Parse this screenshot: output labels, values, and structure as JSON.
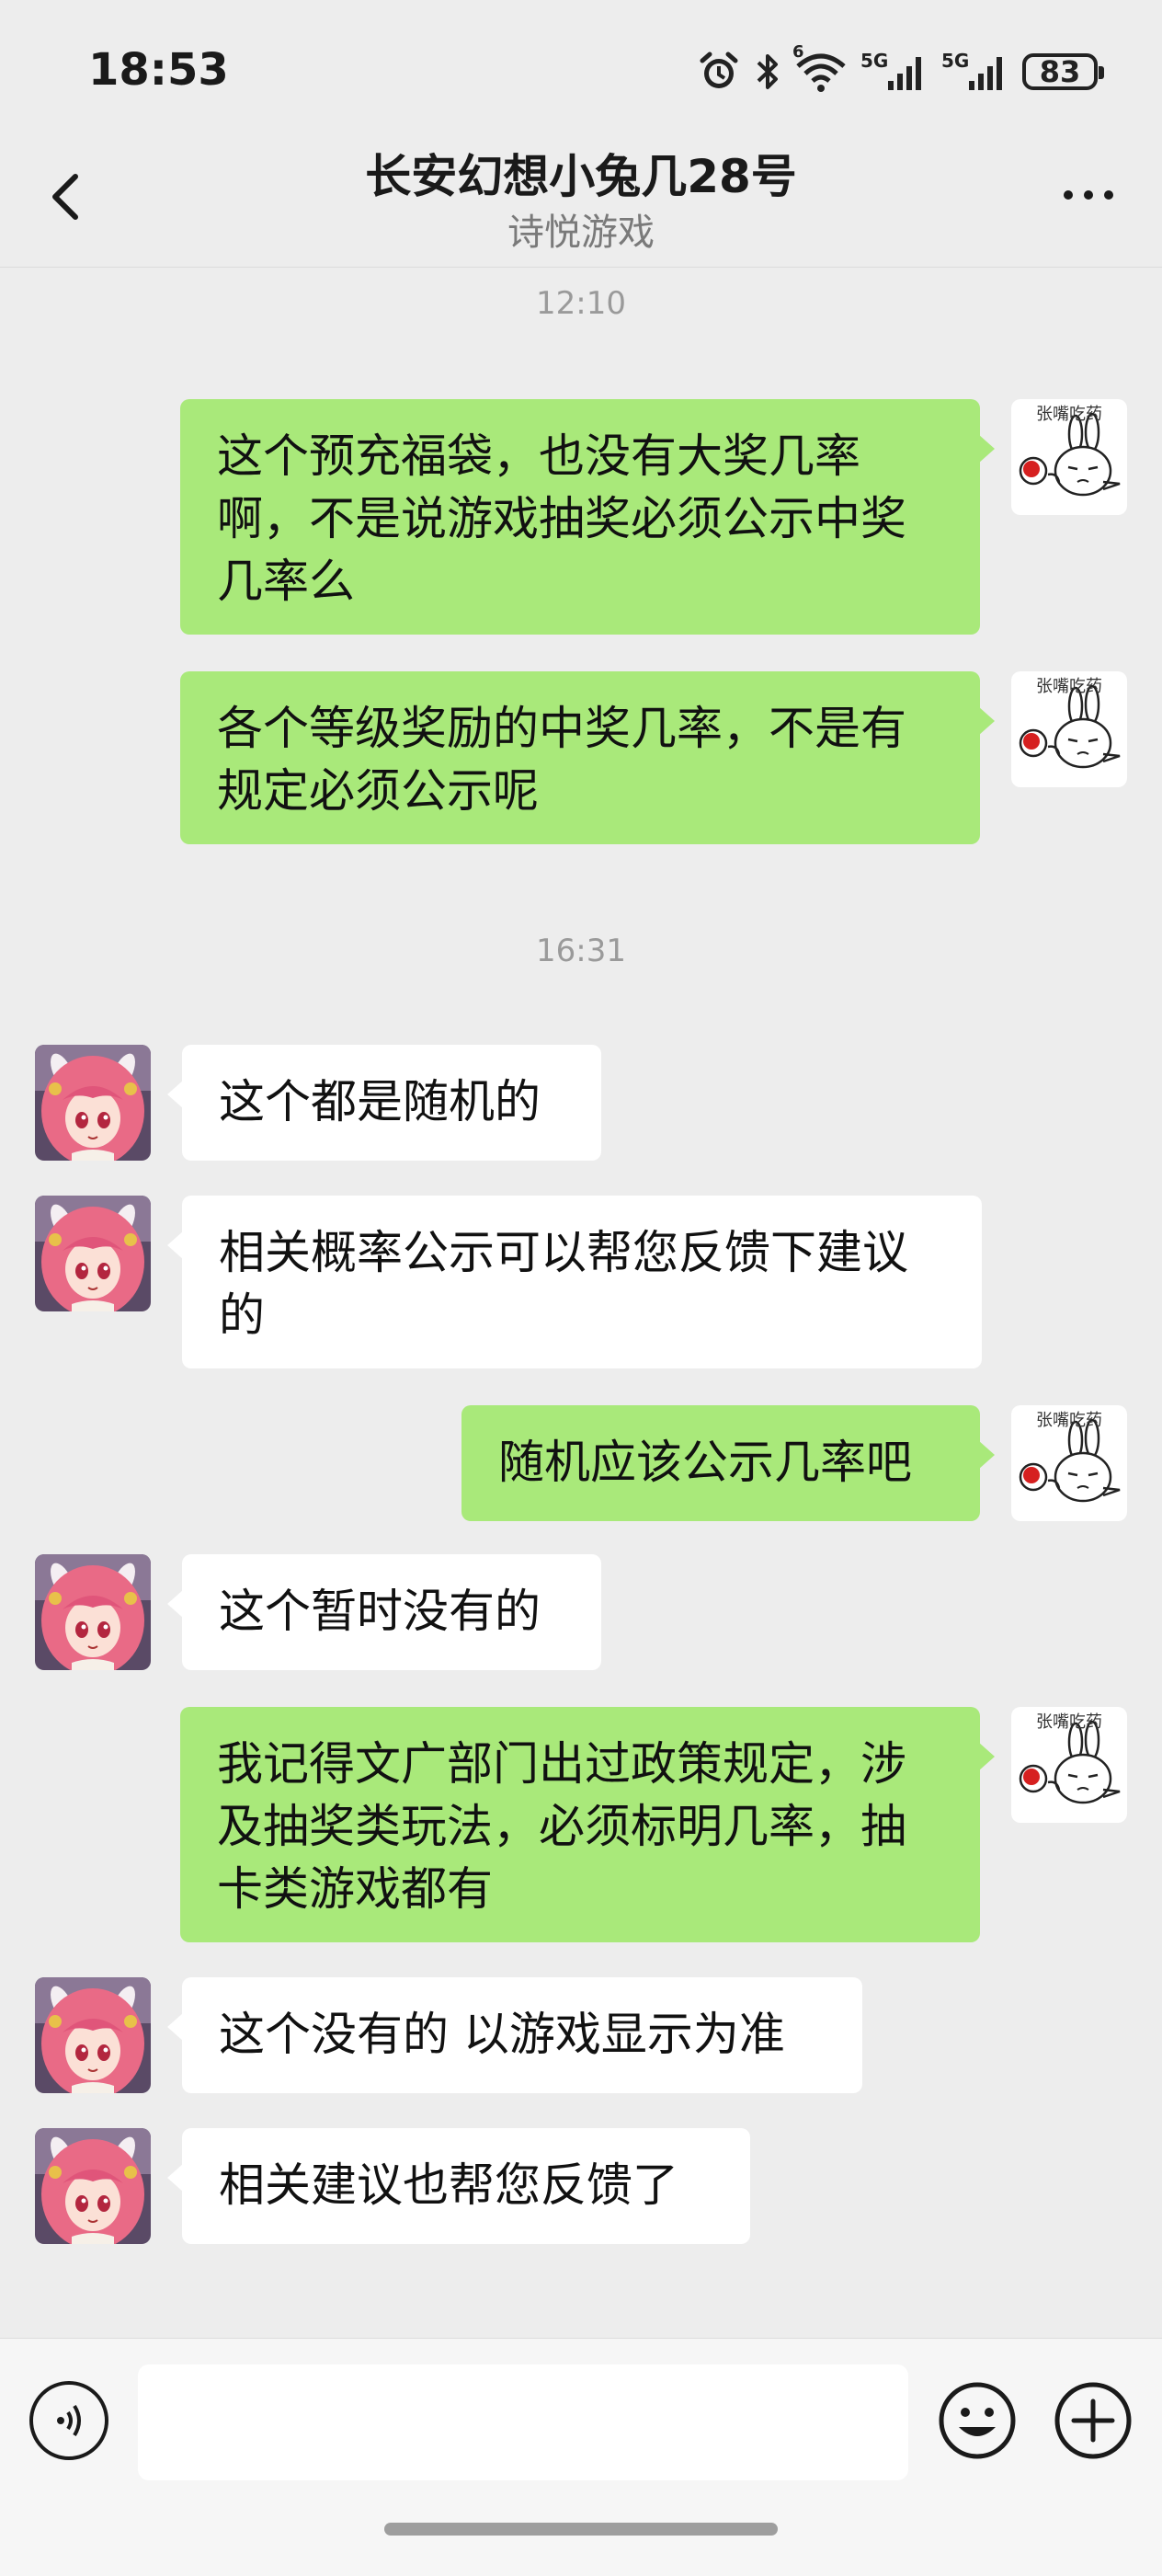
{
  "status_bar": {
    "time": "18:53",
    "battery": "83",
    "network_1": "5G",
    "network_2": "5G",
    "wifi_badge": "6"
  },
  "header": {
    "title": "长安幻想小兔几28号",
    "subtitle": "诗悦游戏"
  },
  "timestamps": [
    "12:10",
    "16:31"
  ],
  "self_avatar_caption": "张嘴吃药",
  "messages": [
    {
      "from": "me",
      "line1": "这个预充福袋，也没有大奖几率",
      "line2": "啊，不是说游戏抽奖必须公示中奖",
      "line3": "几率么"
    },
    {
      "from": "me",
      "line1": "各个等级奖励的中奖几率，不是有",
      "line2": "规定必须公示呢"
    },
    {
      "from": "other",
      "line1": "这个都是随机的"
    },
    {
      "from": "other",
      "line1": "相关概率公示可以帮您反馈下建议",
      "line2": "的"
    },
    {
      "from": "me",
      "line1": "随机应该公示几率吧"
    },
    {
      "from": "other",
      "line1": "这个暂时没有的"
    },
    {
      "from": "me",
      "line1": "我记得文广部门出过政策规定，涉",
      "line2": "及抽奖类玩法，必须标明几率，抽",
      "line3": "卡类游戏都有"
    },
    {
      "from": "other",
      "line1": "这个没有的 以游戏显示为准"
    },
    {
      "from": "other",
      "line1": "相关建议也帮您反馈了"
    }
  ],
  "input": {
    "value": ""
  },
  "colors": {
    "self_bubble": "#a9e97a",
    "other_bubble": "#ffffff",
    "background": "#ededed"
  },
  "icons": [
    "alarm-icon",
    "bluetooth-icon",
    "wifi-icon",
    "signal-icon",
    "battery-icon",
    "back-arrow-icon",
    "more-icon",
    "voice-icon",
    "emoji-icon",
    "plus-icon"
  ]
}
